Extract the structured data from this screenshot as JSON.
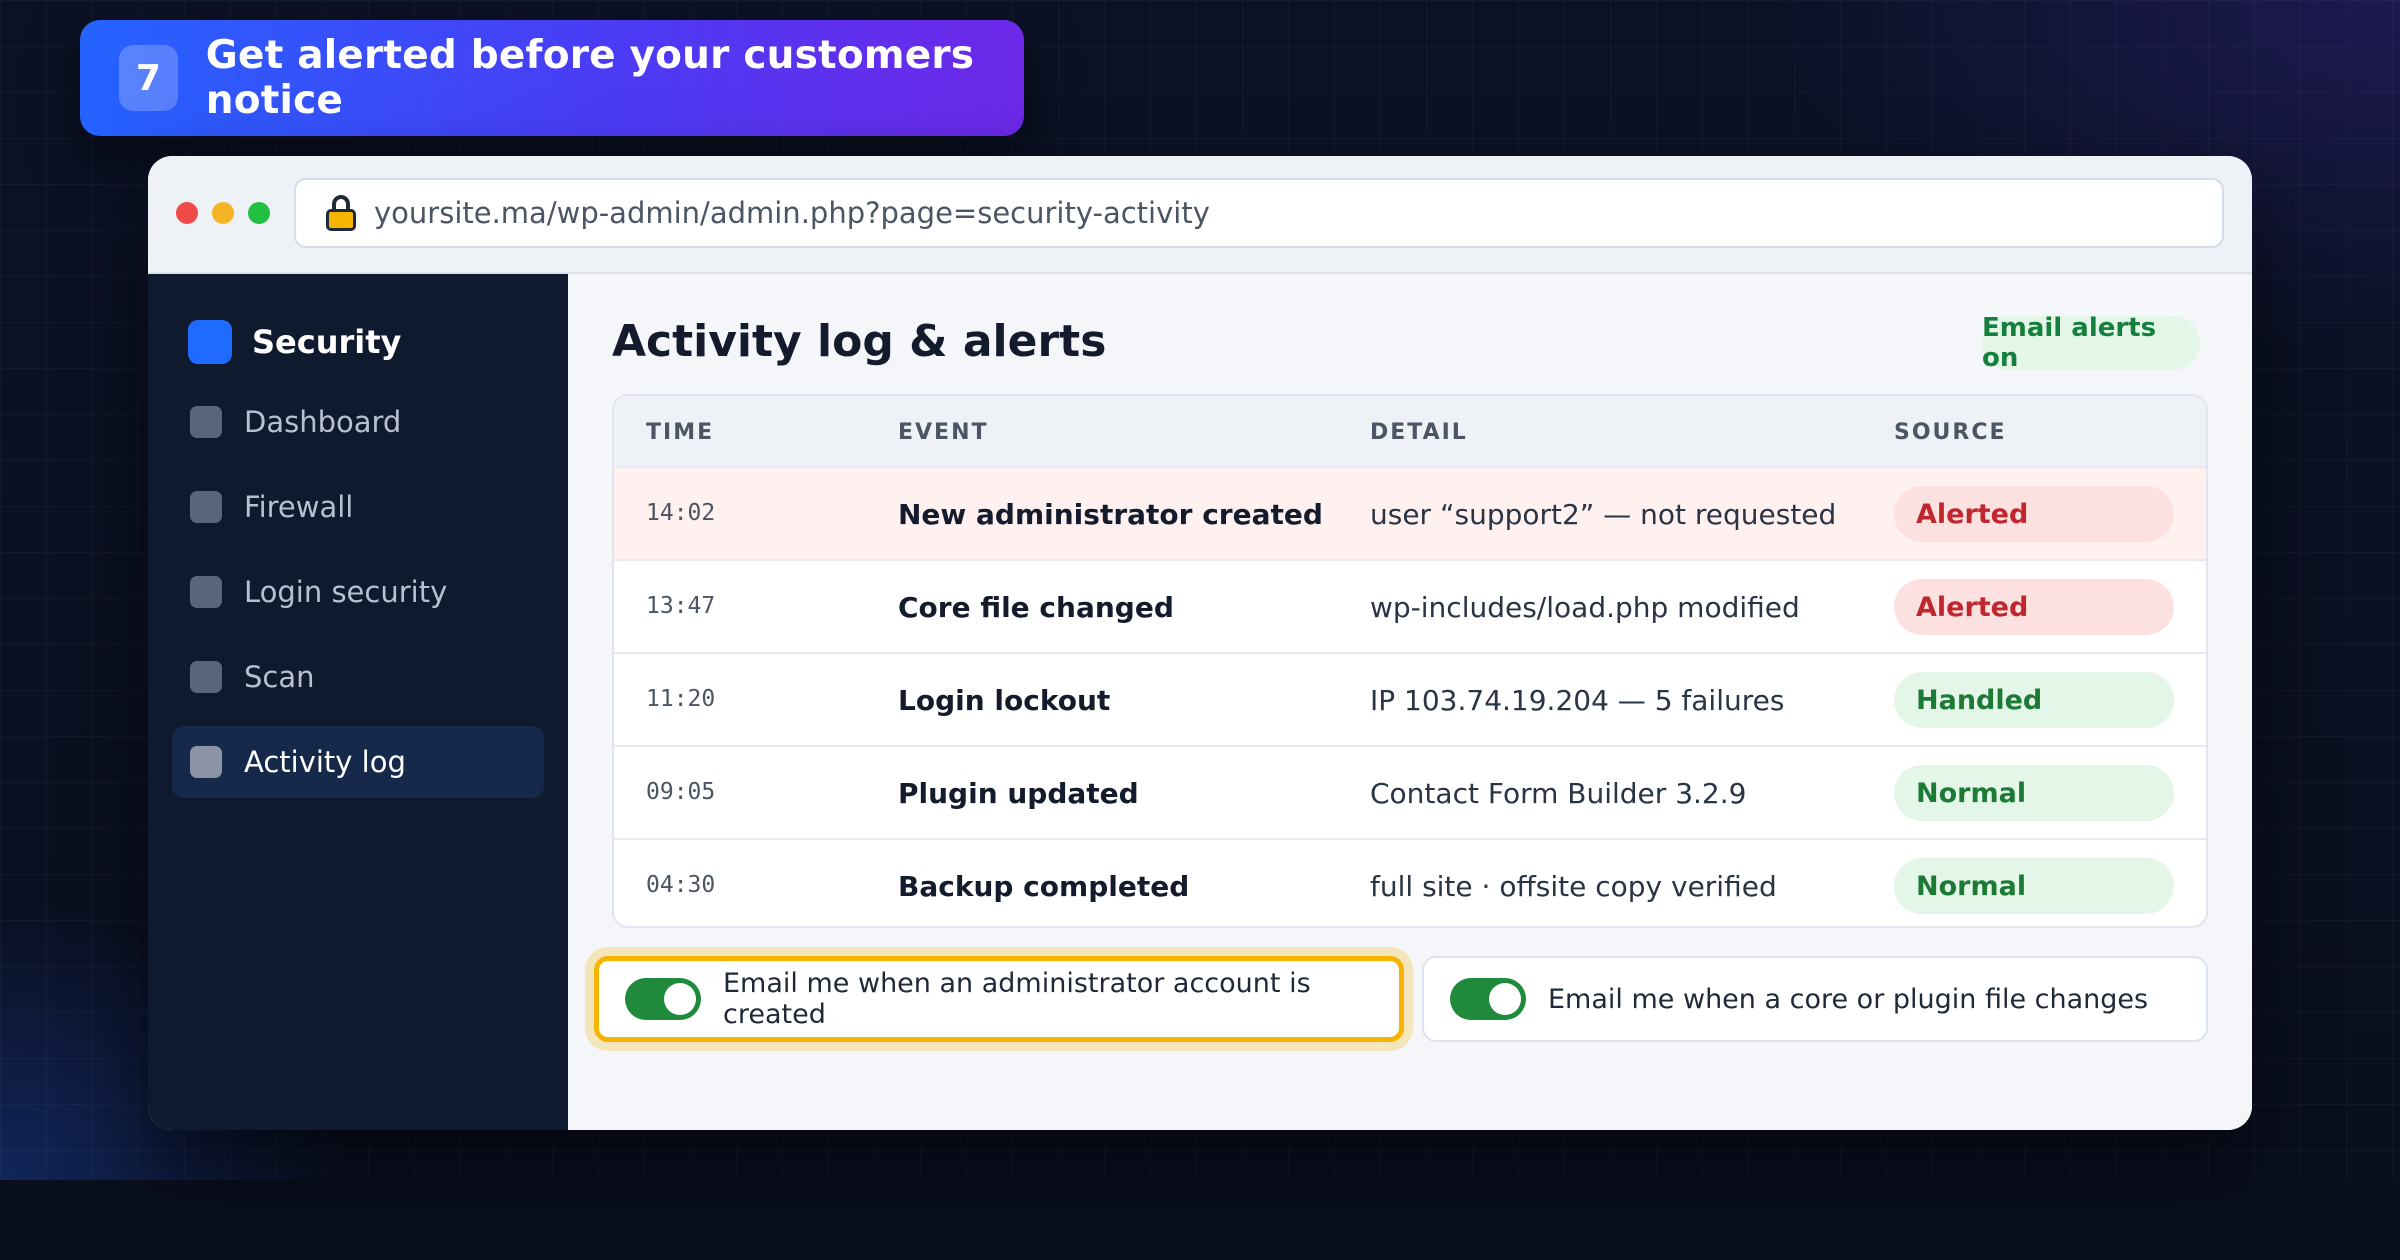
{
  "banner": {
    "step": "7",
    "title": "Get alerted before your customers notice"
  },
  "browser": {
    "url": "yoursite.ma/wp-admin/admin.php?page=security-activity"
  },
  "sidebar": {
    "brand": "Security",
    "items": [
      {
        "label": "Dashboard",
        "active": false
      },
      {
        "label": "Firewall",
        "active": false
      },
      {
        "label": "Login security",
        "active": false
      },
      {
        "label": "Scan",
        "active": false
      },
      {
        "label": "Activity log",
        "active": true
      }
    ]
  },
  "main": {
    "title": "Activity log & alerts",
    "alerts_status": "Email alerts on",
    "table": {
      "headers": [
        "TIME",
        "EVENT",
        "DETAIL",
        "SOURCE"
      ],
      "rows": [
        {
          "time": "14:02",
          "event": "New administrator created",
          "detail": "user “support2” — not requested",
          "source": "Alerted"
        },
        {
          "time": "13:47",
          "event": "Core file changed",
          "detail": "wp-includes/load.php modified",
          "source": "Alerted"
        },
        {
          "time": "11:20",
          "event": "Login lockout",
          "detail": "IP 103.74.19.204 — 5 failures",
          "source": "Handled"
        },
        {
          "time": "09:05",
          "event": "Plugin updated",
          "detail": "Contact Form Builder 3.2.9",
          "source": "Normal"
        },
        {
          "time": "04:30",
          "event": "Backup completed",
          "detail": "full site · offsite copy verified",
          "source": "Normal"
        }
      ]
    },
    "toggles": [
      {
        "label": "Email me when an administrator account is created",
        "on": true
      },
      {
        "label": "Email me when a core or plugin file changes",
        "on": true
      }
    ]
  },
  "colors": {
    "accent": "#1f6bff",
    "highlight": "#f5b400",
    "alert": "#c0262d",
    "ok": "#1c7a35"
  }
}
